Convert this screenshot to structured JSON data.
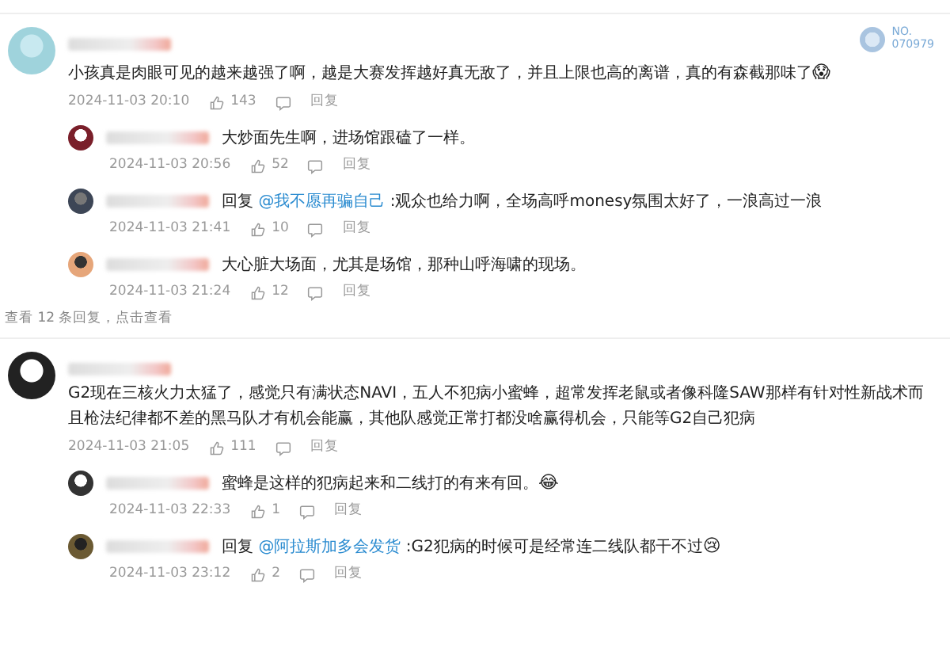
{
  "threads": [
    {
      "badge": {
        "label": "NO.",
        "number": "070979"
      },
      "text": "小孩真是肉眼可见的越来越强了啊，越是大赛发挥越好真无敌了，并且上限也高的离谱，真的有森截那味了",
      "emoji": "😱",
      "date": "2024-11-03 20:10",
      "likes": "143",
      "reply_label": "回复",
      "replies": [
        {
          "text": "大炒面先生啊，进场馆跟磕了一样。",
          "date": "2024-11-03 20:56",
          "likes": "52",
          "reply_label": "回复"
        },
        {
          "prefix": "回复",
          "mention": "@我不愿再骗自己",
          "text": ":观众也给力啊，全场高呼monesy氛围太好了，一浪高过一浪",
          "date": "2024-11-03 21:41",
          "likes": "10",
          "reply_label": "回复"
        },
        {
          "text": "大心脏大场面，尤其是场馆，那种山呼海啸的现场。",
          "date": "2024-11-03 21:24",
          "likes": "12",
          "reply_label": "回复"
        }
      ],
      "more": "查看 12 条回复，点击查看"
    },
    {
      "text": "G2现在三核火力太猛了，感觉只有满状态NAVI，五人不犯病小蜜蜂，超常发挥老鼠或者像科隆SAW那样有针对性新战术而且枪法纪律都不差的黑马队才有机会能赢，其他队感觉正常打都没啥赢得机会，只能等G2自己犯病",
      "date": "2024-11-03 21:05",
      "likes": "111",
      "reply_label": "回复",
      "replies": [
        {
          "text": "蜜蜂是这样的犯病起来和二线打的有来有回。",
          "emoji": "😂",
          "date": "2024-11-03 22:33",
          "likes": "1",
          "reply_label": "回复"
        },
        {
          "prefix": "回复",
          "mention": "@阿拉斯加多会发货",
          "text": ":G2犯病的时候可是经常连二线队都干不过",
          "emoji": "😢",
          "date": "2024-11-03 23:12",
          "likes": "2",
          "reply_label": "回复"
        }
      ]
    }
  ]
}
